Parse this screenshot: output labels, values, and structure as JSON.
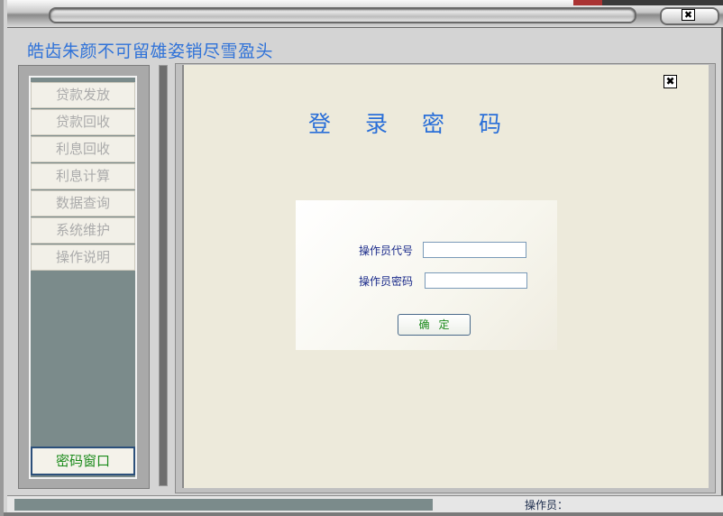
{
  "window": {
    "title": "",
    "close_glyph": "✖"
  },
  "banner": {
    "text": "皓齿朱颜不可留雄姿销尽雪盈头",
    "color": "#2f72d8"
  },
  "sidebar": {
    "items": [
      {
        "label": "贷款发放"
      },
      {
        "label": "贷款回收"
      },
      {
        "label": "利息回收"
      },
      {
        "label": "利息计算"
      },
      {
        "label": "数据查询"
      },
      {
        "label": "系统维护"
      },
      {
        "label": "操作说明"
      }
    ],
    "password_window_label": "密码窗口"
  },
  "content": {
    "close_glyph": "✖",
    "login_title": "登录密码",
    "operator_id_label": "操作员代号",
    "operator_id_value": "",
    "operator_password_label": "操作员密码",
    "operator_password_value": "",
    "confirm_label": "确定"
  },
  "statusbar": {
    "operator_label": "操作员："
  },
  "colors": {
    "menu_text_disabled": "#ababab",
    "accent_green": "#1a8a1a",
    "title_blue": "#2a6fd8",
    "content_bg": "#edeadb"
  }
}
